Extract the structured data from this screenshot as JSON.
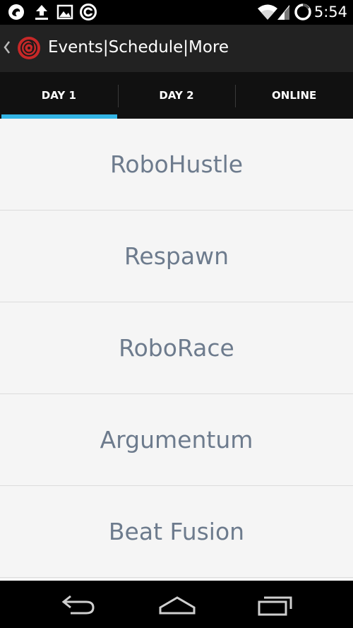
{
  "status_bar": {
    "time": "5:54",
    "icons": [
      "dragon-notification-icon",
      "upload-icon",
      "image-icon",
      "sync-circle-icon",
      "wifi-icon",
      "signal-icon",
      "battery-charging-icon"
    ]
  },
  "action_bar": {
    "title": "Events|Schedule|More",
    "logo": "app-logo-icon",
    "back": "back-caret-icon"
  },
  "tabs": [
    {
      "label": "DAY 1",
      "selected": true
    },
    {
      "label": "DAY 2",
      "selected": false
    },
    {
      "label": "ONLINE",
      "selected": false
    }
  ],
  "events": [
    {
      "name": "RoboHustle"
    },
    {
      "name": "Respawn"
    },
    {
      "name": "RoboRace"
    },
    {
      "name": "Argumentum"
    },
    {
      "name": "Beat Fusion"
    }
  ],
  "nav_bar": {
    "buttons": [
      "back-icon",
      "home-icon",
      "recents-icon"
    ]
  },
  "colors": {
    "accent": "#33b5e5",
    "action_bar_bg": "#222222",
    "tab_bar_bg": "#111111",
    "list_bg": "#f5f5f5",
    "event_text": "#6d7b8d",
    "logo_red": "#c62828"
  }
}
